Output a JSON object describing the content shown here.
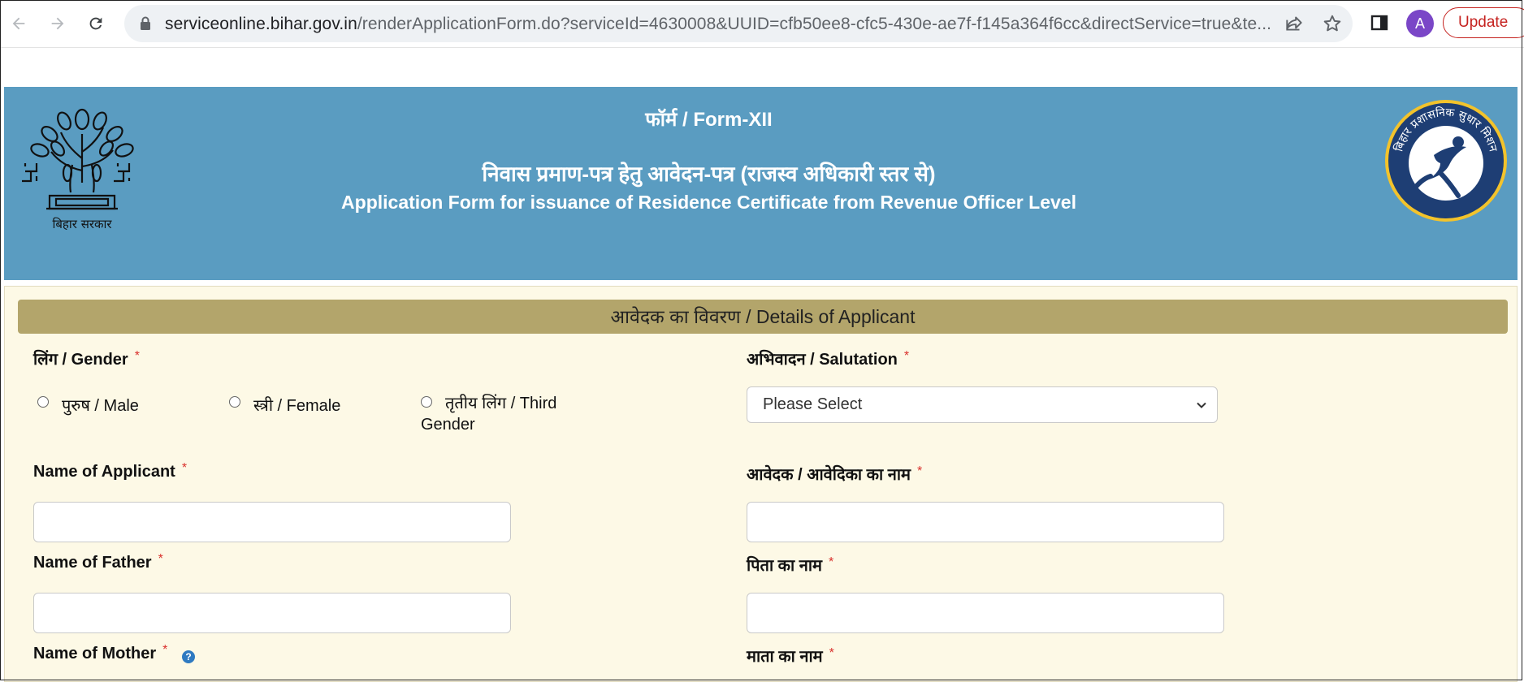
{
  "browser": {
    "url_host": "serviceonline.bihar.gov.in",
    "url_path": "/renderApplicationForm.do?serviceId=4630008&UUID=cfb50ee8-cfc5-430e-ae7f-f145a364f6cc&directService=true&te...",
    "avatar_letter": "A",
    "update_label": "Update"
  },
  "header": {
    "form_title": "फॉर्म / Form-XII",
    "hindi_title": "निवास प्रमाण-पत्र हेतु आवेदन-पत्र (राजस्व अधिकारी स्तर से)",
    "english_title": "Application Form for issuance of  Residence Certificate from Revenue Officer Level",
    "left_logo_caption": "बिहार सरकार",
    "right_logo_text": "बिहार प्रशासनिक सुधार मिशन"
  },
  "form": {
    "section_title": "आवेदक का विवरण / Details of Applicant",
    "gender_label": "लिंग / Gender",
    "gender_options": [
      "पुरुष / Male",
      "स्त्री / Female",
      "तृतीय लिंग / Third",
      "Gender"
    ],
    "salutation_label": "अभिवादन / Salutation",
    "salutation_value": "Please Select",
    "name_label_en": "Name of Applicant",
    "name_label_hi": "आवेदक / आवेदिका का नाम",
    "father_label_en": "Name of Father",
    "father_label_hi": "पिता का नाम",
    "mother_label_en": "Name of Mother",
    "mother_label_hi": "माता का नाम",
    "required_mark": "*",
    "help_mark": "?"
  }
}
